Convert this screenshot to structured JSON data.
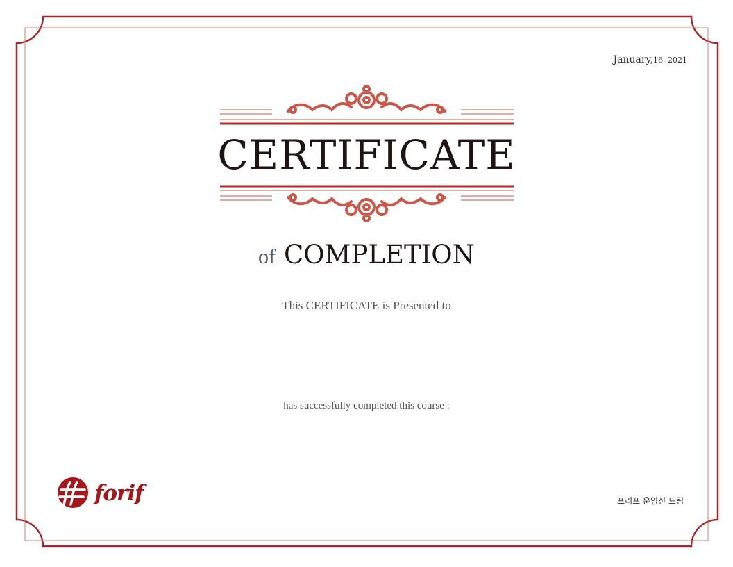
{
  "date": {
    "month": "January,",
    "day_year": "16, 2021"
  },
  "certificate": {
    "title": "CERTIFICATE",
    "subtitle_of": "of",
    "subtitle_main": "COMPLETION",
    "presented_text": "This CERTIFICATE is Presented to",
    "completed_text": "has successfully completed this course :"
  },
  "logo": {
    "text": "forif"
  },
  "issuer": "포리프 운영진 드림",
  "colors": {
    "border": "#a3282b",
    "ornament": "#c9574a",
    "rule": "#b02a2a",
    "title": "#1d1414"
  }
}
